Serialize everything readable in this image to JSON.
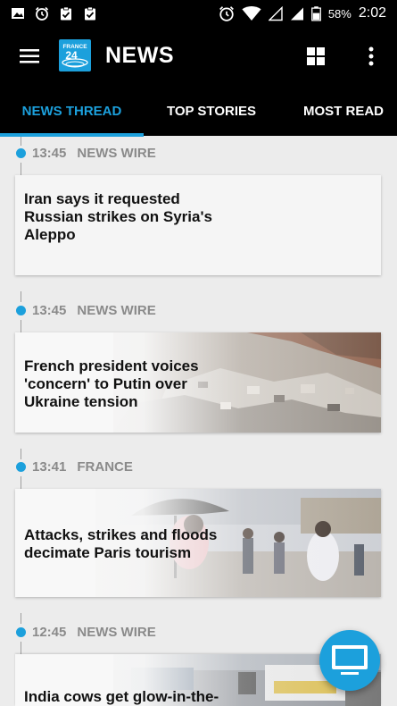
{
  "status_bar": {
    "battery": "58%",
    "time": "2:02",
    "icons": [
      "image-icon",
      "alarm-icon",
      "clipboard-check-icon",
      "clipboard-check-icon",
      "alarm-icon",
      "wifi-icon",
      "signal-icon",
      "battery-icon"
    ]
  },
  "app_bar": {
    "title": "NEWS",
    "logo_text_top": "FRANCE",
    "logo_text_bottom": "24"
  },
  "tabs": [
    {
      "label": "NEWS THREAD",
      "active": true
    },
    {
      "label": "TOP STORIES",
      "active": false
    },
    {
      "label": "MOST READ",
      "active": false
    }
  ],
  "feed": [
    {
      "time": "13:45",
      "category": "NEWS WIRE",
      "headline": "Iran says it requested Russian strikes on Syria's Aleppo",
      "image": "none"
    },
    {
      "time": "13:45",
      "category": "NEWS WIRE",
      "headline": "French president voices 'concern' to Putin over Ukraine tension",
      "image": "rubble-photo"
    },
    {
      "time": "13:41",
      "category": "FRANCE",
      "headline": "Attacks, strikes and floods decimate Paris tourism",
      "image": "tourists-umbrella-photo"
    },
    {
      "time": "12:45",
      "category": "NEWS WIRE",
      "headline": "India cows get glow-in-the-",
      "image": "street-vehicles-photo"
    }
  ],
  "colors": {
    "accent": "#1ca0dc",
    "appbar": "#000000",
    "background": "#ececec"
  }
}
